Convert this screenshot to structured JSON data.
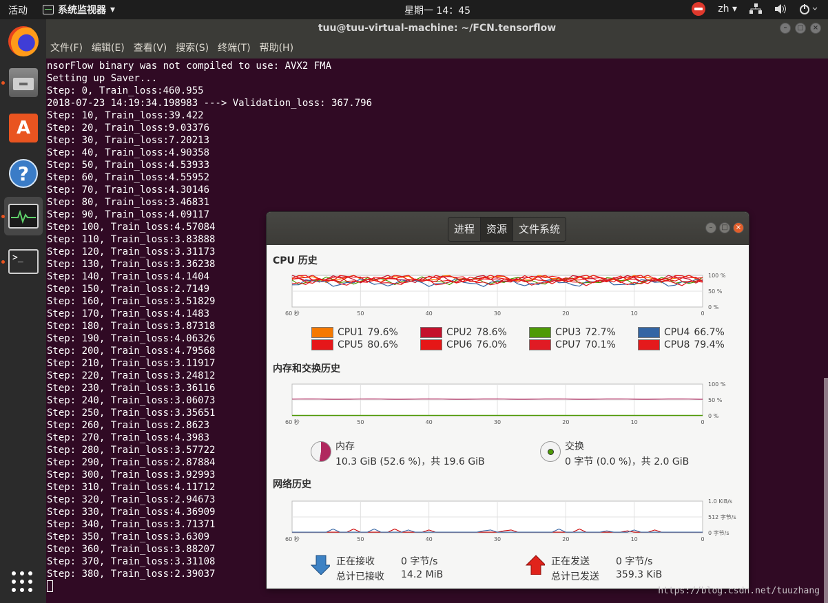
{
  "topbar": {
    "activities": "活动",
    "app_menu": "系统监视器",
    "app_menu_arrow": "▾",
    "clock": "星期一 14：45",
    "lang": "zh",
    "lang_arrow": "▾"
  },
  "dock": {
    "items": [
      "firefox-icon",
      "files-icon",
      "software-center-icon",
      "help-icon",
      "system-monitor-icon",
      "terminal-icon"
    ],
    "store_glyph": "A",
    "help_glyph": "?",
    "terminal_prompt": ">_"
  },
  "terminal": {
    "title": "tuu@tuu-virtual-machine: ~/FCN.tensorflow",
    "menu": [
      "文件(F)",
      "编辑(E)",
      "查看(V)",
      "搜索(S)",
      "终端(T)",
      "帮助(H)"
    ],
    "lines": [
      "nsorFlow binary was not compiled to use: AVX2 FMA",
      "Setting up Saver...",
      "Step: 0, Train_loss:460.955",
      "2018-07-23 14:19:34.198983 ---> Validation_loss: 367.796",
      "Step: 10, Train_loss:39.422",
      "Step: 20, Train_loss:9.03376",
      "Step: 30, Train_loss:7.20213",
      "Step: 40, Train_loss:4.90358",
      "Step: 50, Train_loss:4.53933",
      "Step: 60, Train_loss:4.55952",
      "Step: 70, Train_loss:4.30146",
      "Step: 80, Train_loss:3.46831",
      "Step: 90, Train_loss:4.09117",
      "Step: 100, Train_loss:4.57084",
      "Step: 110, Train_loss:3.83888",
      "Step: 120, Train_loss:3.31173",
      "Step: 130, Train_loss:3.36238",
      "Step: 140, Train_loss:4.1404",
      "Step: 150, Train_loss:2.7149",
      "Step: 160, Train_loss:3.51829",
      "Step: 170, Train_loss:4.1483",
      "Step: 180, Train_loss:3.87318",
      "Step: 190, Train_loss:4.06326",
      "Step: 200, Train_loss:4.79568",
      "Step: 210, Train_loss:3.11917",
      "Step: 220, Train_loss:3.24812",
      "Step: 230, Train_loss:3.36116",
      "Step: 240, Train_loss:3.06073",
      "Step: 250, Train_loss:3.35651",
      "Step: 260, Train_loss:2.8623",
      "Step: 270, Train_loss:4.3983",
      "Step: 280, Train_loss:3.57722",
      "Step: 290, Train_loss:2.87884",
      "Step: 300, Train_loss:3.92993",
      "Step: 310, Train_loss:4.11712",
      "Step: 320, Train_loss:2.94673",
      "Step: 330, Train_loss:4.36909",
      "Step: 340, Train_loss:3.71371",
      "Step: 350, Train_loss:3.6309",
      "Step: 360, Train_loss:3.88207",
      "Step: 370, Train_loss:3.31108",
      "Step: 380, Train_loss:2.39037"
    ]
  },
  "sysmon": {
    "tabs": [
      "进程",
      "资源",
      "文件系统"
    ],
    "active_tab": 1,
    "cpu": {
      "title": "CPU 历史",
      "x_ticks": [
        "60 秒",
        "50",
        "40",
        "30",
        "20",
        "10",
        "0"
      ],
      "y_ticks": [
        "100 %",
        "50 %",
        "0 %"
      ],
      "cores": [
        {
          "name": "CPU1",
          "value": "79.6%",
          "color": "#f57900"
        },
        {
          "name": "CPU2",
          "value": "78.6%",
          "color": "#c4112c"
        },
        {
          "name": "CPU3",
          "value": "72.7%",
          "color": "#4e9a06"
        },
        {
          "name": "CPU4",
          "value": "66.7%",
          "color": "#3465a4"
        },
        {
          "name": "CPU5",
          "value": "80.6%",
          "color": "#e5171a"
        },
        {
          "name": "CPU6",
          "value": "76.0%",
          "color": "#e51717"
        },
        {
          "name": "CPU7",
          "value": "70.1%",
          "color": "#e01b24"
        },
        {
          "name": "CPU8",
          "value": "79.4%",
          "color": "#e41a1c"
        }
      ]
    },
    "memory": {
      "title": "内存和交换历史",
      "x_ticks": [
        "60 秒",
        "50",
        "40",
        "30",
        "20",
        "10",
        "0"
      ],
      "y_ticks": [
        "100 %",
        "50 %",
        "0 %"
      ],
      "mem_label": "内存",
      "mem_value": "10.3 GiB (52.6 %)，共 19.6 GiB",
      "mem_fraction": 0.526,
      "mem_color": "#b0295f",
      "swap_label": "交换",
      "swap_value": "0 字节 (0.0 %)，共 2.0 GiB",
      "swap_color": "#4e9a06"
    },
    "network": {
      "title": "网络历史",
      "x_ticks": [
        "60 秒",
        "50",
        "40",
        "30",
        "20",
        "10",
        "0"
      ],
      "y_ticks": [
        "1.0 KiB/s",
        "512 字节/s",
        "0 字节/s"
      ],
      "recv_label": "正在接收",
      "recv_rate": "0 字节/s",
      "recv_total_label": "总计已接收",
      "recv_total": "14.2 MiB",
      "send_label": "正在发送",
      "send_rate": "0 字节/s",
      "send_total_label": "总计已发送",
      "send_total": "359.3 KiB",
      "recv_color": "#3465a4",
      "send_color": "#cc0000"
    }
  },
  "watermark": "https://blog.csdn.net/tuuzhang"
}
